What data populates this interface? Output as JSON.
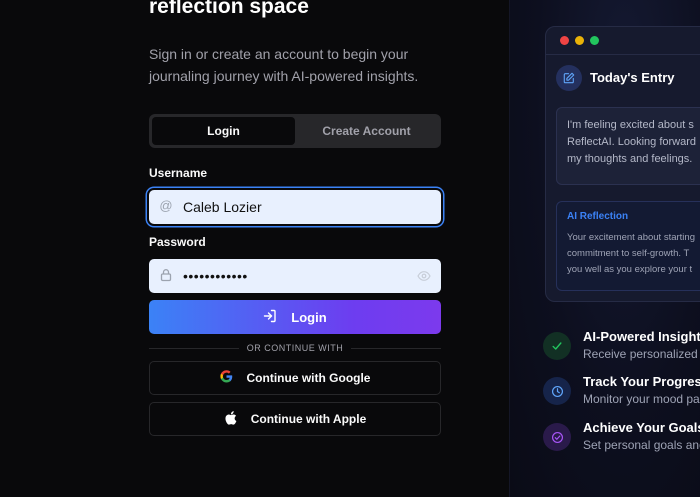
{
  "auth": {
    "heading": "reflection space",
    "subtitle": "Sign in or create an account to begin your journaling journey with AI-powered insights.",
    "tabs": [
      {
        "label": "Login",
        "active": true
      },
      {
        "label": "Create Account",
        "active": false
      }
    ],
    "username_label": "Username",
    "username_value": "Caleb Lozier",
    "password_label": "Password",
    "password_value": "••••••••••••",
    "login_label": "Login",
    "divider_text": "OR CONTINUE WITH",
    "google_label": "Continue with Google",
    "apple_label": "Continue with Apple"
  },
  "preview": {
    "window_dots": [
      "#ef4444",
      "#eab308",
      "#22c55e"
    ],
    "entry_title": "Today's Entry",
    "entry_lines": [
      "I'm feeling excited about s",
      "ReflectAI. Looking forward",
      "my thoughts and feelings."
    ],
    "reflection_title": "AI Reflection",
    "reflection_lines": [
      "Your excitement about starting",
      "commitment to self-growth. T",
      "you well as you explore your t"
    ]
  },
  "features": [
    {
      "title": "AI-Powered Insights",
      "desc": "Receive personalized r",
      "icon": "check-icon",
      "color": "#22c55e"
    },
    {
      "title": "Track Your Progress",
      "desc": "Monitor your mood pa",
      "icon": "clock-icon",
      "color": "#3b82f6"
    },
    {
      "title": "Achieve Your Goals",
      "desc": "Set personal goals and",
      "icon": "check-circle-icon",
      "color": "#a855f7"
    }
  ],
  "colors": {
    "background": "#09090b",
    "accent_blue": "#3b82f6",
    "accent_purple": "#7c3aed"
  }
}
